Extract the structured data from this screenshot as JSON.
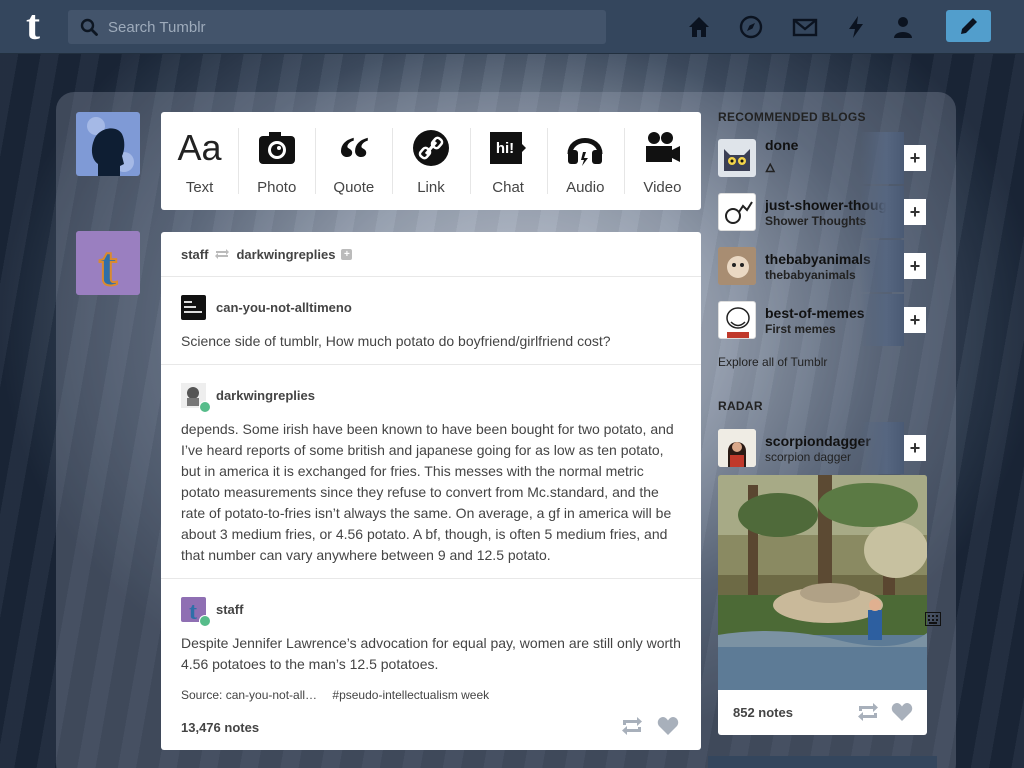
{
  "header": {
    "search_placeholder": "Search Tumblr",
    "nav": [
      "home-icon",
      "explore-icon",
      "inbox-icon",
      "activity-icon",
      "account-icon"
    ],
    "compose_icon": "pencil-icon"
  },
  "post_types": [
    {
      "label": "Text",
      "icon": "text-icon"
    },
    {
      "label": "Photo",
      "icon": "camera-icon"
    },
    {
      "label": "Quote",
      "icon": "quote-icon"
    },
    {
      "label": "Link",
      "icon": "link-icon"
    },
    {
      "label": "Chat",
      "icon": "chat-icon"
    },
    {
      "label": "Audio",
      "icon": "headphones-icon"
    },
    {
      "label": "Video",
      "icon": "video-camera-icon"
    }
  ],
  "post": {
    "author": "staff",
    "reblogged_from": "darkwingreplies",
    "reblogs": [
      {
        "name": "can-you-not-alltimeno",
        "text": "Science side of tumblr, How much potato do boyfriend/girlfriend cost?"
      },
      {
        "name": "darkwingreplies",
        "text": "depends. Some irish have been known to have been bought for two potato, and I’ve heard reports of some british and japanese going for as low as ten potato, but in america it is exchanged for fries. This messes with the normal metric potato measurements since they refuse to convert from Mc.standard, and the rate of potato-to-fries isn’t always the same. On average, a gf in america will be about 3 medium fries, or 4.56 potato. A bf, though, is often 5 medium fries, and that number can vary anywhere between 9 and 12.5 potato."
      },
      {
        "name": "staff",
        "text": "Despite Jennifer Lawrence’s advocation for equal pay, women are still only worth 4.56 potatoes to the man’s 12.5 potatoes."
      }
    ],
    "source": "Source: can-you-not-all…",
    "tag": "#pseudo-intellectualism week",
    "notes": "13,476 notes"
  },
  "sidebar": {
    "recommended_title": "RECOMMENDED BLOGS",
    "recommended": [
      {
        "name": "done",
        "sub": "🜂"
      },
      {
        "name": "just-shower-thoughts",
        "sub": "Shower Thoughts"
      },
      {
        "name": "thebabyanimals",
        "sub": "thebabyanimals"
      },
      {
        "name": "best-of-memes",
        "sub": "First memes"
      }
    ],
    "explore": "Explore all of Tumblr",
    "radar_title": "RADAR",
    "radar": {
      "name": "scorpiondagger",
      "sub": "scorpion dagger",
      "notes": "852 notes"
    }
  },
  "colors": {
    "header": "#34465d",
    "accent": "#529ecc",
    "reblog_badge": "#56bc8a"
  }
}
